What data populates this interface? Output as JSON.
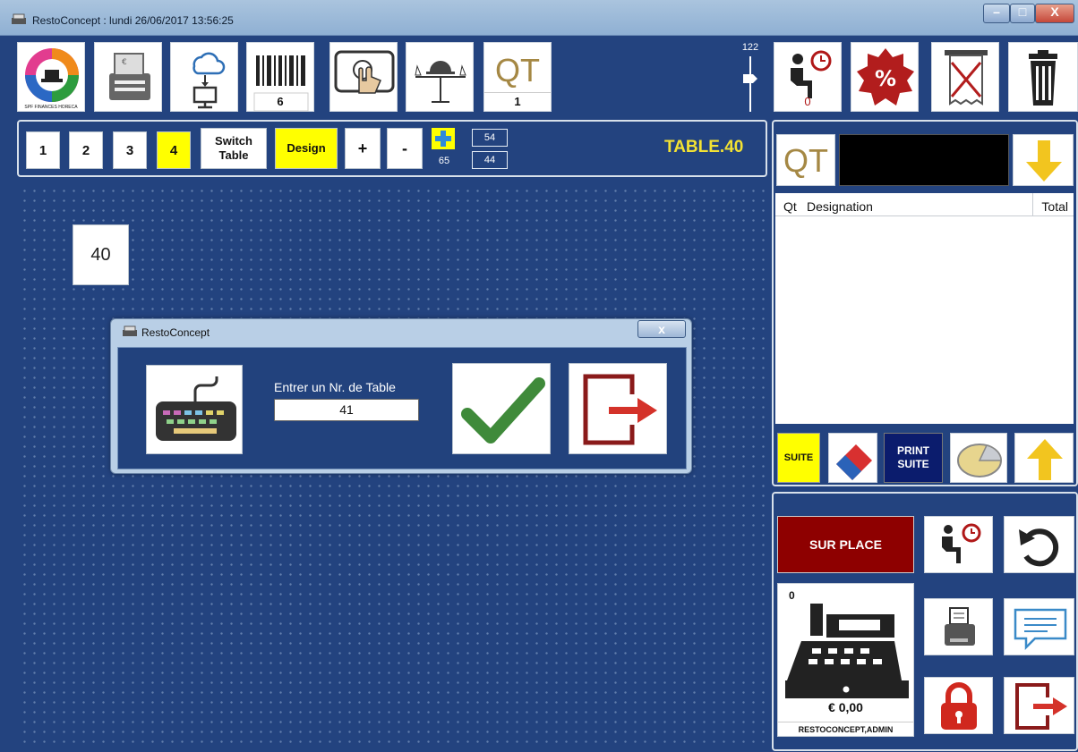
{
  "window": {
    "title": "RestoConcept : lundi 26/06/2017 13:56:25",
    "min": "–",
    "max": "□",
    "close": "X"
  },
  "toolbar": {
    "logo_caption": "SPF FINANCES HORECA",
    "barcode_count": "6",
    "qt_label": "QT",
    "qt_value": "1",
    "slider_value": "122",
    "waiting_count": "0"
  },
  "tables_bar": {
    "levels": [
      "1",
      "2",
      "3",
      "4"
    ],
    "active_level": "4",
    "switch_label": "Switch Table",
    "design_label": "Design",
    "plus_label": "+",
    "minus_label": "-",
    "zoom_value": "65",
    "width_value": "54",
    "height_value": "44",
    "current_table": "TABLE.40"
  },
  "floor": {
    "tables": [
      "40"
    ]
  },
  "dialog": {
    "title": "RestoConcept",
    "close": "x",
    "prompt": "Entrer un Nr. de Table",
    "value": "41"
  },
  "order": {
    "qt_label": "QT",
    "columns": {
      "qt": "Qt",
      "designation": "Designation",
      "total": "Total"
    },
    "suite_label": "SUITE",
    "print_suite_label": "PRINT SUITE"
  },
  "register": {
    "mode_label": "SUR PLACE",
    "count": "0",
    "amount": "€ 0,00",
    "user": "RESTOCONCEPT,ADMIN"
  },
  "colors": {
    "background": "#23437f",
    "accent_yellow": "#ffff00",
    "table_label": "#f3e233",
    "surplace": "#8e0000"
  }
}
